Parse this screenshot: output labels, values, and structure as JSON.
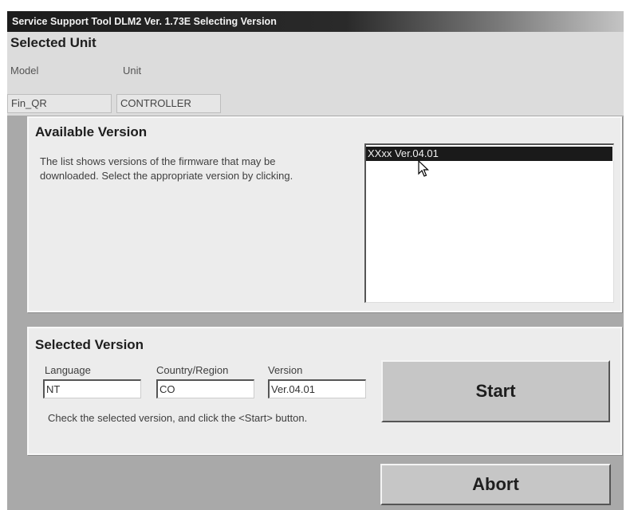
{
  "window": {
    "title": "Service Support Tool DLM2 Ver. 1.73E  Selecting Version"
  },
  "selected_unit": {
    "title": "Selected Unit",
    "model_label": "Model",
    "unit_label": "Unit",
    "model_value": "Fin_QR",
    "unit_value": "CONTROLLER"
  },
  "available_version": {
    "title": "Available Version",
    "description": "The list shows versions of the firmware that may be downloaded. Select the appropriate version by clicking.",
    "items": [
      "XXxx Ver.04.01"
    ],
    "selected_index": 0
  },
  "selected_version": {
    "title": "Selected Version",
    "language_label": "Language",
    "language_value": "NT",
    "country_label": "Country/Region",
    "country_value": "CO",
    "version_label": "Version",
    "version_value": "Ver.04.01",
    "instruction": "Check the selected version, and click the <Start> button."
  },
  "buttons": {
    "start": "Start",
    "abort": "Abort"
  },
  "icons": {
    "cursor": "mouse-pointer-icon"
  },
  "colors": {
    "selection": "#1a1a1a",
    "frame": "#a9a9a9",
    "panel": "#ececec"
  }
}
